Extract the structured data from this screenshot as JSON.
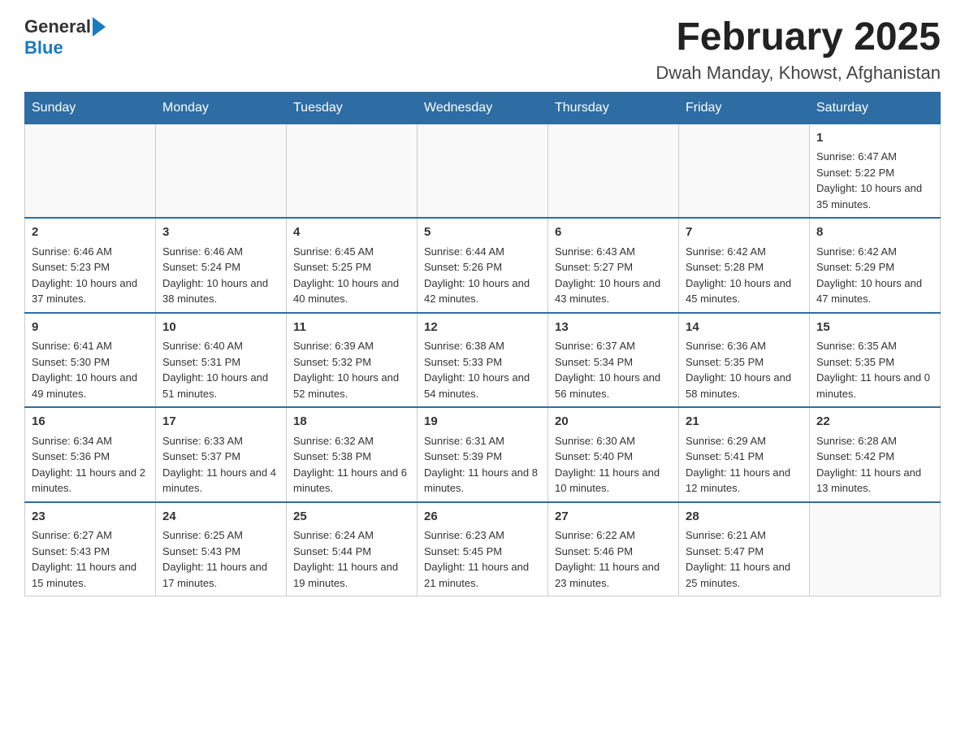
{
  "logo": {
    "general": "General",
    "blue": "Blue"
  },
  "title": "February 2025",
  "subtitle": "Dwah Manday, Khowst, Afghanistan",
  "days_of_week": [
    "Sunday",
    "Monday",
    "Tuesday",
    "Wednesday",
    "Thursday",
    "Friday",
    "Saturday"
  ],
  "weeks": [
    [
      {
        "day": "",
        "info": ""
      },
      {
        "day": "",
        "info": ""
      },
      {
        "day": "",
        "info": ""
      },
      {
        "day": "",
        "info": ""
      },
      {
        "day": "",
        "info": ""
      },
      {
        "day": "",
        "info": ""
      },
      {
        "day": "1",
        "info": "Sunrise: 6:47 AM\nSunset: 5:22 PM\nDaylight: 10 hours and 35 minutes."
      }
    ],
    [
      {
        "day": "2",
        "info": "Sunrise: 6:46 AM\nSunset: 5:23 PM\nDaylight: 10 hours and 37 minutes."
      },
      {
        "day": "3",
        "info": "Sunrise: 6:46 AM\nSunset: 5:24 PM\nDaylight: 10 hours and 38 minutes."
      },
      {
        "day": "4",
        "info": "Sunrise: 6:45 AM\nSunset: 5:25 PM\nDaylight: 10 hours and 40 minutes."
      },
      {
        "day": "5",
        "info": "Sunrise: 6:44 AM\nSunset: 5:26 PM\nDaylight: 10 hours and 42 minutes."
      },
      {
        "day": "6",
        "info": "Sunrise: 6:43 AM\nSunset: 5:27 PM\nDaylight: 10 hours and 43 minutes."
      },
      {
        "day": "7",
        "info": "Sunrise: 6:42 AM\nSunset: 5:28 PM\nDaylight: 10 hours and 45 minutes."
      },
      {
        "day": "8",
        "info": "Sunrise: 6:42 AM\nSunset: 5:29 PM\nDaylight: 10 hours and 47 minutes."
      }
    ],
    [
      {
        "day": "9",
        "info": "Sunrise: 6:41 AM\nSunset: 5:30 PM\nDaylight: 10 hours and 49 minutes."
      },
      {
        "day": "10",
        "info": "Sunrise: 6:40 AM\nSunset: 5:31 PM\nDaylight: 10 hours and 51 minutes."
      },
      {
        "day": "11",
        "info": "Sunrise: 6:39 AM\nSunset: 5:32 PM\nDaylight: 10 hours and 52 minutes."
      },
      {
        "day": "12",
        "info": "Sunrise: 6:38 AM\nSunset: 5:33 PM\nDaylight: 10 hours and 54 minutes."
      },
      {
        "day": "13",
        "info": "Sunrise: 6:37 AM\nSunset: 5:34 PM\nDaylight: 10 hours and 56 minutes."
      },
      {
        "day": "14",
        "info": "Sunrise: 6:36 AM\nSunset: 5:35 PM\nDaylight: 10 hours and 58 minutes."
      },
      {
        "day": "15",
        "info": "Sunrise: 6:35 AM\nSunset: 5:35 PM\nDaylight: 11 hours and 0 minutes."
      }
    ],
    [
      {
        "day": "16",
        "info": "Sunrise: 6:34 AM\nSunset: 5:36 PM\nDaylight: 11 hours and 2 minutes."
      },
      {
        "day": "17",
        "info": "Sunrise: 6:33 AM\nSunset: 5:37 PM\nDaylight: 11 hours and 4 minutes."
      },
      {
        "day": "18",
        "info": "Sunrise: 6:32 AM\nSunset: 5:38 PM\nDaylight: 11 hours and 6 minutes."
      },
      {
        "day": "19",
        "info": "Sunrise: 6:31 AM\nSunset: 5:39 PM\nDaylight: 11 hours and 8 minutes."
      },
      {
        "day": "20",
        "info": "Sunrise: 6:30 AM\nSunset: 5:40 PM\nDaylight: 11 hours and 10 minutes."
      },
      {
        "day": "21",
        "info": "Sunrise: 6:29 AM\nSunset: 5:41 PM\nDaylight: 11 hours and 12 minutes."
      },
      {
        "day": "22",
        "info": "Sunrise: 6:28 AM\nSunset: 5:42 PM\nDaylight: 11 hours and 13 minutes."
      }
    ],
    [
      {
        "day": "23",
        "info": "Sunrise: 6:27 AM\nSunset: 5:43 PM\nDaylight: 11 hours and 15 minutes."
      },
      {
        "day": "24",
        "info": "Sunrise: 6:25 AM\nSunset: 5:43 PM\nDaylight: 11 hours and 17 minutes."
      },
      {
        "day": "25",
        "info": "Sunrise: 6:24 AM\nSunset: 5:44 PM\nDaylight: 11 hours and 19 minutes."
      },
      {
        "day": "26",
        "info": "Sunrise: 6:23 AM\nSunset: 5:45 PM\nDaylight: 11 hours and 21 minutes."
      },
      {
        "day": "27",
        "info": "Sunrise: 6:22 AM\nSunset: 5:46 PM\nDaylight: 11 hours and 23 minutes."
      },
      {
        "day": "28",
        "info": "Sunrise: 6:21 AM\nSunset: 5:47 PM\nDaylight: 11 hours and 25 minutes."
      },
      {
        "day": "",
        "info": ""
      }
    ]
  ]
}
